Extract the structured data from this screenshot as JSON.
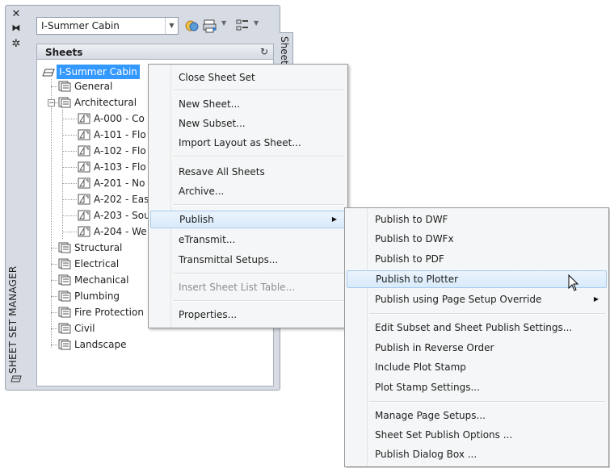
{
  "palette": {
    "title": "SHEET SET MANAGER",
    "side_tab": "Sheet List",
    "sheet_set_combo": "I-Summer Cabin",
    "sheets_header": "Sheets",
    "strip_icons": [
      "close-icon",
      "auto-hide-icon",
      "properties-icon"
    ]
  },
  "tree": {
    "root": "I-Summer Cabin",
    "subsets": [
      {
        "label": "General",
        "expanded": false
      },
      {
        "label": "Architectural",
        "expanded": true,
        "sheets": [
          "A-000 - Co",
          "A-101 - Flo",
          "A-102 - Flo",
          "A-103 - Flo",
          "A-201 - No",
          "A-202 - Eas",
          "A-203 - Sou",
          "A-204 - We"
        ]
      },
      {
        "label": "Structural"
      },
      {
        "label": "Electrical"
      },
      {
        "label": "Mechanical"
      },
      {
        "label": "Plumbing"
      },
      {
        "label": "Fire Protection"
      },
      {
        "label": "Civil"
      },
      {
        "label": "Landscape"
      }
    ]
  },
  "context_menu": {
    "items": [
      "Close Sheet Set",
      "New Sheet...",
      "New Subset...",
      "Import Layout as Sheet...",
      "Resave All Sheets",
      "Archive...",
      "Publish",
      "eTransmit...",
      "Transmittal Setups...",
      "Insert Sheet List Table...",
      "Properties..."
    ]
  },
  "publish_submenu": {
    "items": [
      "Publish to DWF",
      "Publish to DWFx",
      "Publish to PDF",
      "Publish to Plotter",
      "Publish using Page Setup Override",
      "Edit Subset and Sheet Publish Settings...",
      "Publish in Reverse Order",
      "Include Plot Stamp",
      "Plot Stamp Settings...",
      "Manage Page Setups...",
      "Sheet Set Publish Options ...",
      "Publish Dialog Box ..."
    ]
  }
}
